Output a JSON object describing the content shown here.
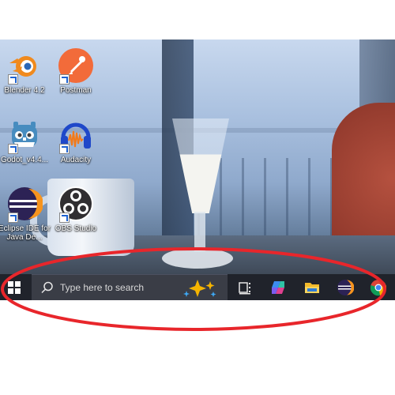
{
  "desktop": {
    "icons": [
      {
        "label": "Blender 4.2",
        "icon": "blender-icon",
        "color": "#f08a1e"
      },
      {
        "label": "Postman",
        "icon": "postman-icon",
        "color": "#f26b3a"
      },
      {
        "label": "Godot_v4.4...",
        "icon": "godot-icon",
        "color": "#478cbf"
      },
      {
        "label": "Audacity",
        "icon": "audacity-icon",
        "color": "#1f48c9"
      },
      {
        "label": "Eclipse IDE for Java De...",
        "icon": "eclipse-icon",
        "color": "#2c2255"
      },
      {
        "label": "OBS Studio",
        "icon": "obs-icon",
        "color": "#302e31"
      }
    ]
  },
  "taskbar": {
    "start_icon": "windows-start-icon",
    "search": {
      "placeholder": "Type here to search",
      "icon": "search-icon"
    },
    "search_highlight_icon": "sparkle-icon",
    "pinned": [
      {
        "name": "Task View",
        "icon": "task-view-icon"
      },
      {
        "name": "Copilot",
        "icon": "copilot-icon"
      },
      {
        "name": "File Explorer",
        "icon": "file-explorer-icon"
      },
      {
        "name": "Eclipse",
        "icon": "eclipse-taskbar-icon"
      },
      {
        "name": "Chrome",
        "icon": "chrome-icon"
      }
    ],
    "background": "#20232b"
  },
  "annotation": {
    "shape": "ellipse",
    "color": "#e8262b"
  }
}
